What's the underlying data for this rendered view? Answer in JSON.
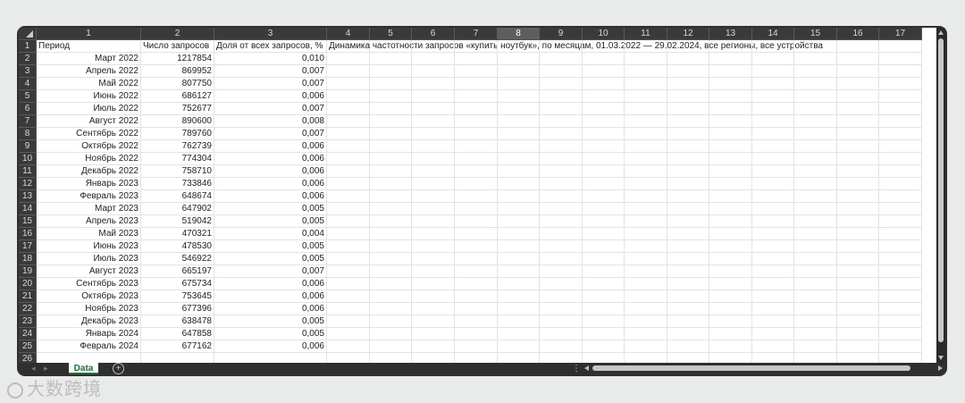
{
  "column_headers": [
    "1",
    "2",
    "3",
    "4",
    "5",
    "6",
    "7",
    "8",
    "9",
    "10",
    "11",
    "12",
    "13",
    "14",
    "15",
    "16",
    "17"
  ],
  "active_column": "8",
  "header_row": {
    "period": "Период",
    "requests": "Число запросов",
    "share": "Доля от всех запросов, %",
    "title": "Динамика частотности запросов «купить ноутбук», по месяцам, 01.03.2022 — 29.02.2024, все регионы, все устройства"
  },
  "rows": [
    {
      "n": "2",
      "period": "Март 2022",
      "requests": "1217854",
      "share": "0,010"
    },
    {
      "n": "3",
      "period": "Апрель 2022",
      "requests": "869952",
      "share": "0,007"
    },
    {
      "n": "4",
      "period": "Май 2022",
      "requests": "807750",
      "share": "0,007"
    },
    {
      "n": "5",
      "period": "Июнь 2022",
      "requests": "686127",
      "share": "0,006"
    },
    {
      "n": "6",
      "period": "Июль 2022",
      "requests": "752677",
      "share": "0,007"
    },
    {
      "n": "7",
      "period": "Август 2022",
      "requests": "890600",
      "share": "0,008"
    },
    {
      "n": "8",
      "period": "Сентябрь 2022",
      "requests": "789760",
      "share": "0,007"
    },
    {
      "n": "9",
      "period": "Октябрь 2022",
      "requests": "762739",
      "share": "0,006"
    },
    {
      "n": "10",
      "period": "Ноябрь 2022",
      "requests": "774304",
      "share": "0,006"
    },
    {
      "n": "11",
      "period": "Декабрь 2022",
      "requests": "758710",
      "share": "0,006"
    },
    {
      "n": "12",
      "period": "Январь 2023",
      "requests": "733846",
      "share": "0,006"
    },
    {
      "n": "13",
      "period": "Февраль 2023",
      "requests": "648674",
      "share": "0,006"
    },
    {
      "n": "14",
      "period": "Март 2023",
      "requests": "647902",
      "share": "0,005"
    },
    {
      "n": "15",
      "period": "Апрель 2023",
      "requests": "519042",
      "share": "0,005"
    },
    {
      "n": "16",
      "period": "Май 2023",
      "requests": "470321",
      "share": "0,004"
    },
    {
      "n": "17",
      "period": "Июнь 2023",
      "requests": "478530",
      "share": "0,005"
    },
    {
      "n": "18",
      "period": "Июль 2023",
      "requests": "546922",
      "share": "0,005"
    },
    {
      "n": "19",
      "period": "Август 2023",
      "requests": "665197",
      "share": "0,007"
    },
    {
      "n": "20",
      "period": "Сентябрь 2023",
      "requests": "675734",
      "share": "0,006"
    },
    {
      "n": "21",
      "period": "Октябрь 2023",
      "requests": "753645",
      "share": "0,006"
    },
    {
      "n": "22",
      "period": "Ноябрь 2023",
      "requests": "677396",
      "share": "0,006"
    },
    {
      "n": "23",
      "period": "Декабрь 2023",
      "requests": "638478",
      "share": "0,005"
    },
    {
      "n": "24",
      "period": "Январь 2024",
      "requests": "647858",
      "share": "0,005"
    },
    {
      "n": "25",
      "period": "Февраль 2024",
      "requests": "677162",
      "share": "0,006"
    },
    {
      "n": "26",
      "period": "",
      "requests": "",
      "share": ""
    }
  ],
  "sheet_tab": "Data",
  "watermark": "大数跨境",
  "icons": {
    "add_sheet": "plus-circle-icon",
    "select_all": "triangle-icon"
  }
}
